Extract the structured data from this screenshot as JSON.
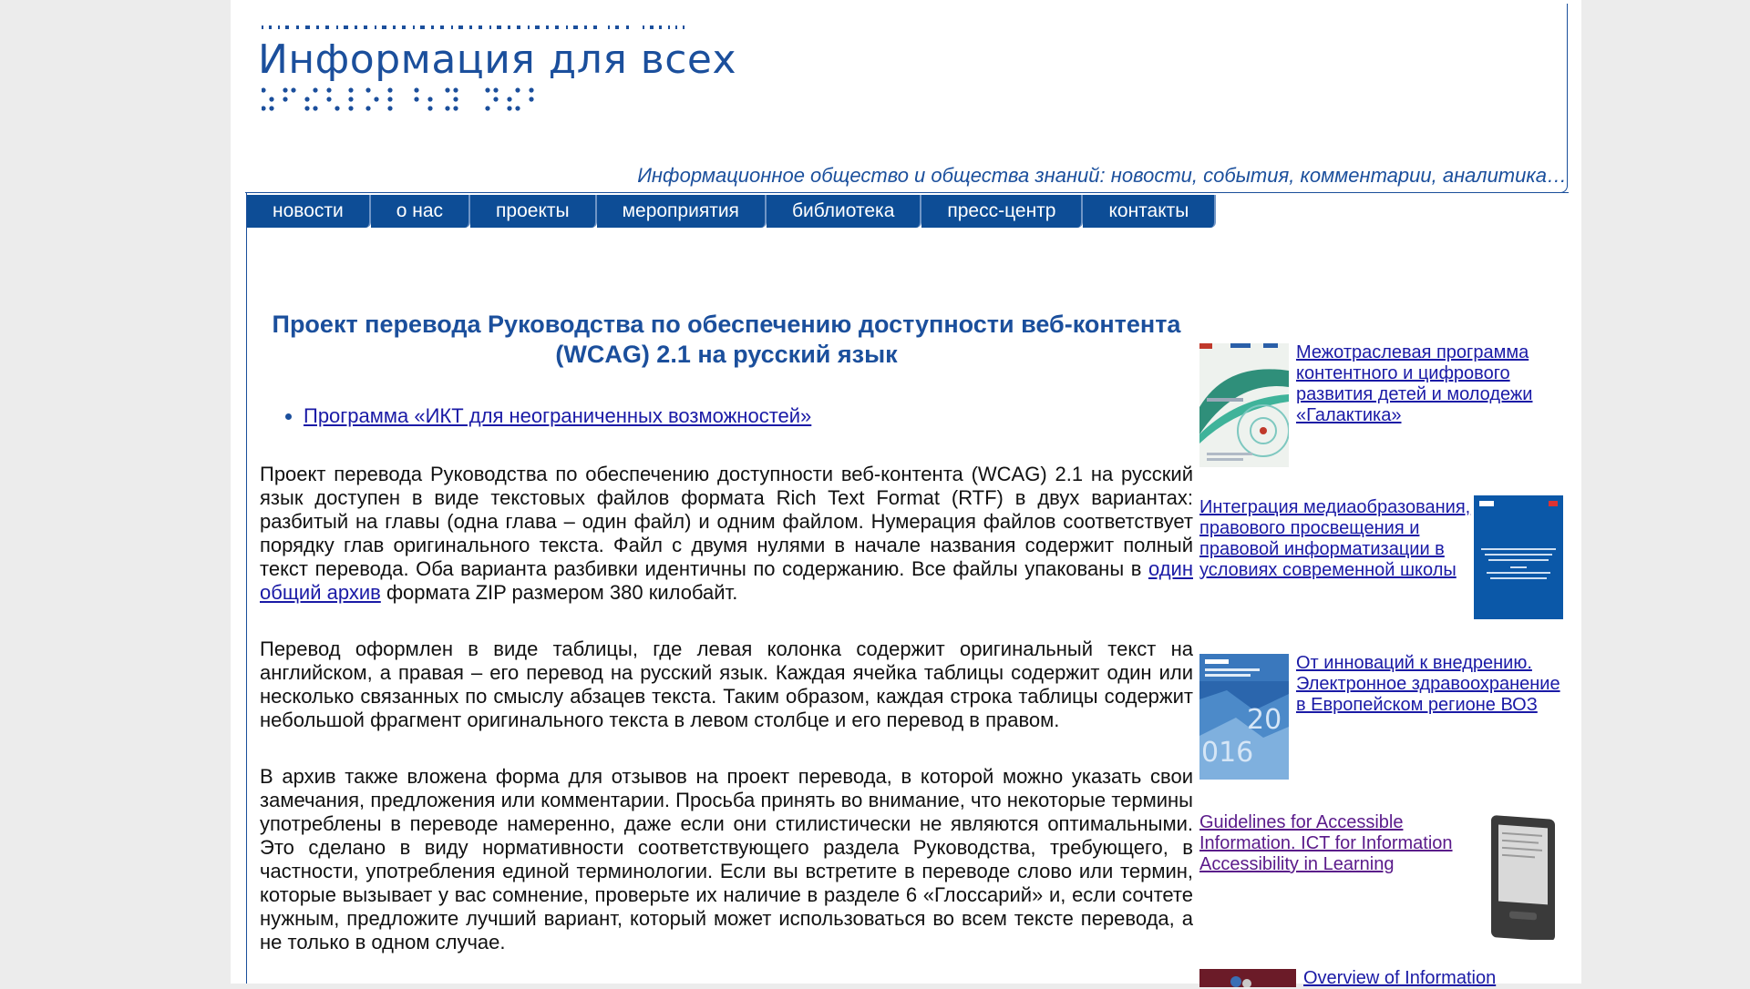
{
  "header": {
    "logo_title": "Информация для всех",
    "tagline": "Информационное общество и общества знаний: новости, события, комментарии, аналитика…"
  },
  "nav": {
    "items": [
      {
        "label": "новости"
      },
      {
        "label": "о нас"
      },
      {
        "label": "проекты"
      },
      {
        "label": "мероприятия"
      },
      {
        "label": "библиотека"
      },
      {
        "label": "пресс-центр"
      },
      {
        "label": "контакты"
      }
    ]
  },
  "article": {
    "title": "Проект перевода Руководства по обеспечению доступности веб-контента (WCAG) 2.1 на русский язык",
    "program_link": "Программа «ИКТ для неограниченных возможностей»",
    "p1_before": "Проект перевода Руководства по обеспечению доступности веб-контента (WCAG) 2.1 на русский язык доступен в виде текстовых файлов формата Rich Text Format (RTF) в двух вариантах: разбитый на главы (одна глава – один файл) и одним файлом. Нумерация файлов соответствует порядку глав оригинального текста. Файл с двумя нулями в начале названия содержит полный текст перевода. Оба варианта разбивки идентичны по содержанию. Все файлы упакованы в ",
    "p1_link": "один общий архив",
    "p1_after": " формата ZIP размером 380 килобайт.",
    "p2": "Перевод оформлен в виде таблицы, где левая колонка содержит оригинальный текст на английском, а правая – его перевод на русский язык. Каждая ячейка таблицы содержит один или несколько связанных по смыслу абзацев текста. Таким образом, каждая строка таблицы содержит небольшой фрагмент оригинального текста в левом столбце и его перевод в правом.",
    "p3": "В архив также вложена форма для отзывов на проект перевода, в которой можно указать свои замечания, предложения или комментарии. Просьба принять во внимание, что некоторые термины употреблены в переводе намеренно, даже если они стилистически не являются оптимальными. Это сделано в виду нормативности соответствующего раздела Руководства, требующего, в частности, употребления единой терминологии. Если вы встретите в переводе слово или термин, которые вызывает у вас сомнение, проверьте их наличие в разделе 6 «Глоссарий» и, если сочтете нужным, предложите лучший вариант, который может использоваться во всем тексте перевода, а не только в одном случае."
  },
  "sidebar": {
    "items": [
      {
        "label": "Межотраслевая программа контентного и цифрового развития детей и молодежи «Галактика»"
      },
      {
        "label": "Интеграция медиаобразования, правового просвещения и правовой информатизации в условиях современной школы"
      },
      {
        "label": "От инноваций к внедрению. Электронное здравоохранение в Европейском регионе ВОЗ"
      },
      {
        "label": "Guidelines for Accessible Information. ICT for Information Accessibility in Learning"
      },
      {
        "label": "Overview of Information"
      }
    ]
  },
  "colors": {
    "brand_blue": "#1b4f9c",
    "nav_bg": "#0d4d96",
    "link": "#1a1aa6",
    "visited_link": "#5a1a8a"
  }
}
